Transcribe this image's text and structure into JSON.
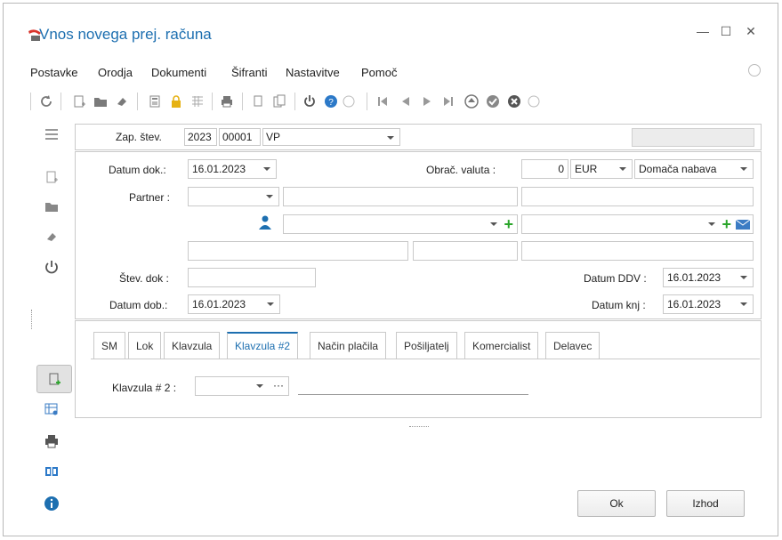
{
  "window": {
    "title": "Vnos novega prej. računa",
    "minimize_glyph": "—",
    "maximize_glyph": "☐",
    "close_glyph": "✕"
  },
  "menu": {
    "items": [
      "Postavke",
      "Orodja",
      "Dokumenti",
      "Šifranti",
      "Nastavitve",
      "Pomoč"
    ]
  },
  "toolbar": {
    "icons": [
      "refresh-icon",
      "new-icon",
      "open-folder-icon",
      "eraser-icon",
      "calculator-icon",
      "lock-icon",
      "grid-icon",
      "print-icon",
      "copy-icon",
      "paste-icon",
      "power-icon",
      "help-icon",
      "collapse-icon",
      "first-icon",
      "prev-icon",
      "next-icon",
      "last-icon",
      "eject-icon",
      "confirm-icon",
      "cancel-icon",
      "more-icon"
    ]
  },
  "header": {
    "zap_label": "Zap. štev.",
    "year": "2023",
    "number": "00001",
    "type": "VP",
    "status_value": ""
  },
  "form": {
    "datum_dok_label": "Datum dok.:",
    "datum_dok_value": "16.01.2023",
    "obrac_valuta_label": "Obrač. valuta :",
    "obrac_valuta_value": "0",
    "currency": "EUR",
    "nabava": "Domača nabava",
    "partner_label": "Partner :",
    "partner_value": "",
    "stev_dok_label": "Štev. dok :",
    "stev_dok_value": "",
    "datum_ddv_label": "Datum DDV :",
    "datum_ddv_value": "16.01.2023",
    "datum_dob_label": "Datum dob.:",
    "datum_dob_value": "16.01.2023",
    "datum_knj_label": "Datum knj :",
    "datum_knj_value": "16.01.2023"
  },
  "tabs": [
    "SM",
    "Lok",
    "Klavzula",
    "Klavzula #2",
    "Način plačila",
    "Pošiljatelj",
    "Komercialist",
    "Delavec"
  ],
  "active_tab": "Klavzula #2",
  "tab_content": {
    "klavzula2_label": "Klavzula # 2 :",
    "klavzula2_value": "",
    "ellipsis": "···"
  },
  "buttons": {
    "ok": "Ok",
    "cancel": "Izhod"
  },
  "colors": {
    "accent": "#1d6fb0",
    "green_plus": "#2aa52a",
    "border": "#c9c9c9"
  }
}
